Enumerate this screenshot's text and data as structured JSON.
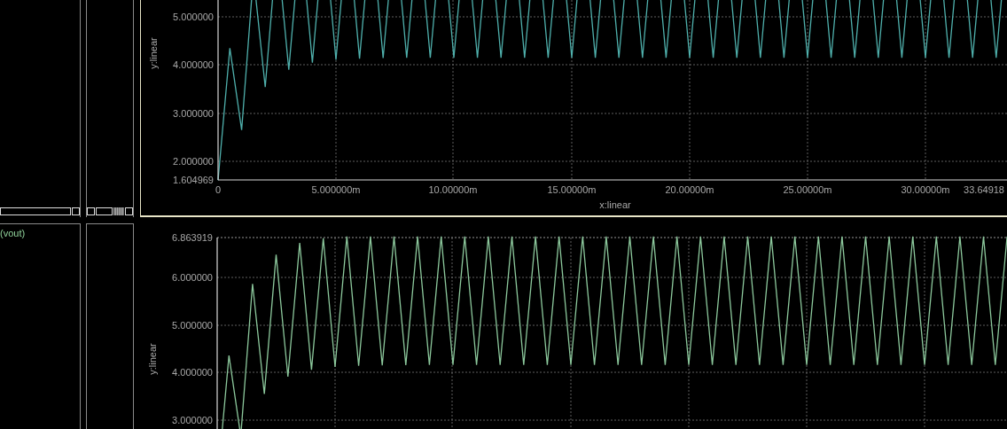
{
  "signal_list": {
    "label": "(vout)"
  },
  "plots": [
    {
      "y_axis_label": "y:linear",
      "x_axis_label": "x:linear",
      "color": "#4fb0ac",
      "y_ticks": [
        "5.000000",
        "4.000000",
        "3.000000",
        "2.000000",
        "1.604969"
      ],
      "x_ticks": [
        "0",
        "5.000000m",
        "10.00000m",
        "15.00000m",
        "20.00000m",
        "25.00000m",
        "30.00000m",
        "33.64918"
      ]
    },
    {
      "y_axis_label": "y:linear",
      "color": "#8cc89c",
      "y_ticks": [
        "6.863919",
        "6.000000",
        "5.000000",
        "4.000000",
        "3.000000"
      ]
    }
  ]
}
